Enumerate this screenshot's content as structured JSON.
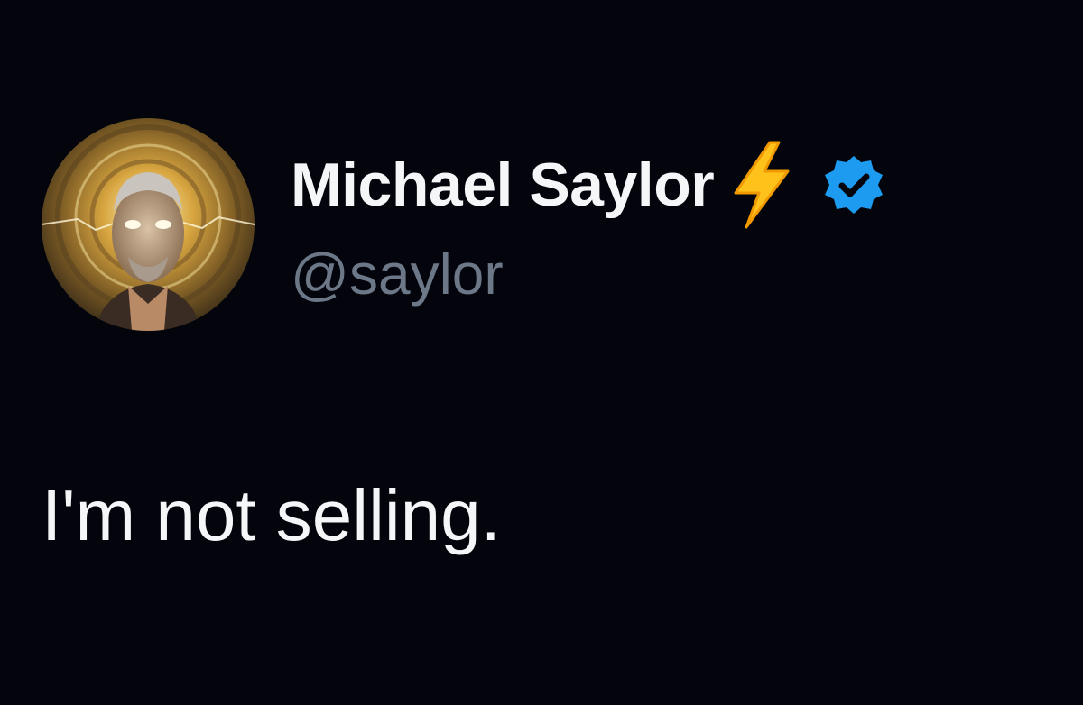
{
  "tweet": {
    "author": {
      "display_name": "Michael Saylor",
      "handle": "@saylor",
      "name_emoji": "high-voltage-emoji",
      "verified_badge": "verified-badge-icon",
      "verified_color": "#1d9bf0",
      "avatar": "profile-avatar"
    },
    "text": "I'm not selling."
  },
  "colors": {
    "background": "#03040c",
    "primary_text": "#f5f6f8",
    "secondary_text": "#6c7888",
    "accent": "#1d9bf0"
  }
}
